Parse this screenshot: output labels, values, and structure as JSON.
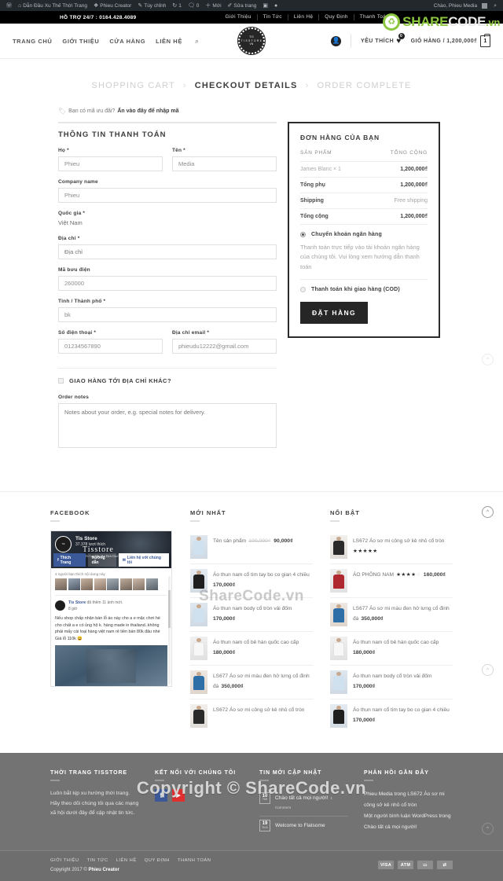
{
  "adminbar": {
    "items": [
      {
        "icon": "wordpress-icon",
        "label": ""
      },
      {
        "icon": "site-icon",
        "label": "Dẫn Đầu Xu Thế Thời Trang"
      },
      {
        "icon": "customize-brand-icon",
        "label": "Phieu Creator"
      },
      {
        "icon": "pencil-icon",
        "label": "Tùy chỉnh"
      },
      {
        "icon": "updates-icon",
        "label": "1"
      },
      {
        "icon": "comment-icon",
        "label": "0"
      },
      {
        "icon": "plus-icon",
        "label": "Mới"
      },
      {
        "icon": "edit-icon",
        "label": "Sửa trang"
      },
      {
        "icon": "sq-icon",
        "label": ""
      },
      {
        "icon": "dot-icon",
        "label": ""
      }
    ],
    "greeting": "Chào, Phieu Media",
    "search_icon": "search-icon"
  },
  "topbar": {
    "support": "HỖ TRỢ 24/7 : 0164.428.4089",
    "nav": [
      "Giới Thiệu",
      "Tin Tức",
      "Liên Hệ",
      "Quy Định",
      "Thanh Toán"
    ]
  },
  "watermark": {
    "logo_a": "SHARE",
    "logo_b": "CODE",
    "logo_c": ".vn",
    "middle": "ShareCode.vn",
    "big": "Copyright © ShareCode.vn"
  },
  "header": {
    "nav": [
      "TRANG CHỦ",
      "GIỚI THIỆU",
      "CỬA HÀNG",
      "LIÊN HỆ"
    ],
    "search_icon": "search-icon",
    "logo_line1": "TIS",
    "logo_line2": "T I S S T O R E",
    "logo_line3": "VN",
    "account_icon": "account-icon",
    "wishlist_label": "YÊU THÍCH",
    "wishlist_count": "0",
    "cart_label": "GIỎ HÀNG / 1,200,000₫",
    "cart_count": "1"
  },
  "steps": [
    {
      "label": "SHOPPING CART",
      "active": false
    },
    {
      "label": "CHECKOUT DETAILS",
      "active": true
    },
    {
      "label": "ORDER COMPLETE",
      "active": false
    }
  ],
  "coupon": {
    "prefix": "Bạn có mã ưu đãi?",
    "link": "Ấn vào đây để nhập mã",
    "icon": "tag-icon"
  },
  "billing": {
    "title": "THÔNG TIN THANH TOÁN",
    "fields": {
      "first_name_label": "Họ *",
      "first_name_value": "Phieu",
      "last_name_label": "Tên *",
      "last_name_value": "Media",
      "company_label": "Company name",
      "company_value": "Phieu",
      "country_label": "Quốc gia *",
      "country_value": "Việt Nam",
      "address_label": "Địa chỉ *",
      "address_placeholder": "Địa chỉ",
      "postcode_label": "Mã bưu điện",
      "postcode_value": "260000",
      "city_label": "Tỉnh / Thành phố *",
      "city_value": "bk",
      "phone_label": "Số điện thoại *",
      "phone_value": "01234567890",
      "email_label": "Địa chỉ email *",
      "email_value": "phieudu12222@gmail.com"
    },
    "ship_different": "GIAO HÀNG TỚI ĐỊA CHỈ KHÁC?",
    "notes_label": "Order notes",
    "notes_placeholder": "Notes about your order, e.g. special notes for delivery."
  },
  "order": {
    "title": "ĐƠN HÀNG CỦA BẠN",
    "col_product": "SẢN PHẨM",
    "col_total": "TỔNG CỘNG",
    "rows": [
      {
        "name": "James Blanc  × 1",
        "value": "1,200,000₫",
        "type": "product"
      },
      {
        "name": "Tổng phụ",
        "value": "1,200,000₫",
        "type": "sum"
      },
      {
        "name": "Shipping",
        "value": "Free shipping",
        "type": "free"
      },
      {
        "name": "Tổng cộng",
        "value": "1,200,000₫",
        "type": "sum"
      }
    ],
    "payments": [
      {
        "label": "Chuyển khoản ngân hàng",
        "selected": true
      },
      {
        "label": "Thanh toán khi giao hàng (COD)",
        "selected": false
      }
    ],
    "payment_desc": "Thanh toán trực tiếp vào tài khoản ngân hàng của chúng tôi. Vui lòng xem hướng dẫn thanh toán",
    "place_order": "ĐẶT HÀNG"
  },
  "widgets": {
    "facebook": {
      "title": "FACEBOOK",
      "page_name": "Tis Store",
      "likes": "37.378 lượt thích",
      "brand": "Tisstore",
      "address": "Add: Ngõ 75 Tổ 1 ng Mầu Mai Dịch Cầu Giấy Hn",
      "tagline": "Chuyên áo thể thao nam",
      "btn_like": "Thích Trang",
      "btn_more": "Hướng dẫn",
      "btn_contact": "Liên hệ với chúng tôi",
      "friends_note": "4 người bạn thích nội dung này",
      "post_author": "Tis Store",
      "post_action": "đã thêm 11 ảnh mới.",
      "post_time": "8 giờ",
      "post_text": "Nếu shop chấp nhận bán lỗ áo này cho a e mặc chơi hè cho chất a e có ủng hộ k. hàng made in thailand..không phải mấy cái loại hàng việt nam rẻ tiền bán 80k đâu nhé\nGiá lỗ 110k 😀"
    },
    "latest": {
      "title": "MỚI NHẤT",
      "items": [
        {
          "name": "Tên sản phẩm",
          "old_price": "100,000₫",
          "price": "90,000₫",
          "thumb": "t-lightblue"
        },
        {
          "name": "Áo thun nam cổ tim tay bo co gian 4 chiều",
          "price": "170,000₫",
          "thumb": "t-black"
        },
        {
          "name": "Áo thun nam body cổ tròn vải đốm",
          "price": "170,000₫",
          "thumb": "t-lightblue"
        },
        {
          "name": "Áo thun nam cổ bẻ hàn quốc cao cấp",
          "price": "180,000₫",
          "thumb": "t-white"
        },
        {
          "name": "LS677 Áo sơ mi màu đen hở lưng cổ đinh đá",
          "price": "350,000₫",
          "thumb": "t-blue"
        },
        {
          "name": "LS672 Áo sơ mi công sở kẻ nhỏ cổ tròn",
          "price": "",
          "thumb": "t-darkgray"
        }
      ]
    },
    "featured": {
      "title": "NỔI BẬT",
      "items": [
        {
          "name": "LS672 Áo sơ mi công sở kẻ nhỏ cổ tròn",
          "price": "",
          "stars": 5,
          "thumb": "t-darkgray"
        },
        {
          "name": "ÁO PHÔNG NAM",
          "price": "160,000₫",
          "stars": 4,
          "thumb": "t-red"
        },
        {
          "name": "LS677 Áo sơ mi màu đen hở lưng cổ đinh đá",
          "price": "350,000₫",
          "stars": 0,
          "thumb": "t-blue"
        },
        {
          "name": "Áo thun nam cổ bẻ hàn quốc cao cấp",
          "price": "180,000₫",
          "stars": 0,
          "thumb": "t-white"
        },
        {
          "name": "Áo thun nam body cổ tròn vải đốm",
          "price": "170,000₫",
          "stars": 0,
          "thumb": "t-lightblue"
        },
        {
          "name": "Áo thun nam cổ tim tay bo co gian 4 chiều",
          "price": "170,000₫",
          "stars": 0,
          "thumb": "t-black"
        }
      ]
    }
  },
  "footer": {
    "about": {
      "title": "THỜI TRANG TISSTORE",
      "text": "Luôn bắt kịp xu hướng thời trang. Hãy theo dõi chúng tôi qua các mạng xã hội dưới đây để cập nhật tin tức."
    },
    "connect": {
      "title": "KẾT NỐI VỚI CHÚNG TÔI",
      "facebook_icon": "facebook-icon",
      "youtube_icon": "youtube-icon"
    },
    "news": {
      "title": "TIN MỚI CẬP NHẬT",
      "items": [
        {
          "day": "10",
          "month": "Th5",
          "title": "Chào tất cả mọi người!",
          "comments": "1 Comment"
        },
        {
          "day": "19",
          "month": "Th11",
          "title": "Welcome to Flatsome",
          "comments": ""
        }
      ]
    },
    "comments": {
      "title": "PHẢN HỒI GẦN ĐÂY",
      "items": [
        "Phieu Media trong LS672 Áo sơ mi công sở kẻ nhỏ cổ tròn",
        "Một người bình luận WordPress trong Chào tất cả mọi người!"
      ]
    },
    "bottom_nav": [
      "GIỚI THIỆU",
      "TIN TỨC",
      "LIÊN HỆ",
      "QUY ĐỊNH",
      "THANH TOÁN"
    ],
    "copyright_prefix": "Copyright 2017 © ",
    "copyright_brand": "Phieu Creator",
    "pay_icons": [
      "VISA",
      "ATM",
      "card-icon",
      "transfer-icon"
    ]
  },
  "scroll_top_icon": "chevron-up-icon"
}
